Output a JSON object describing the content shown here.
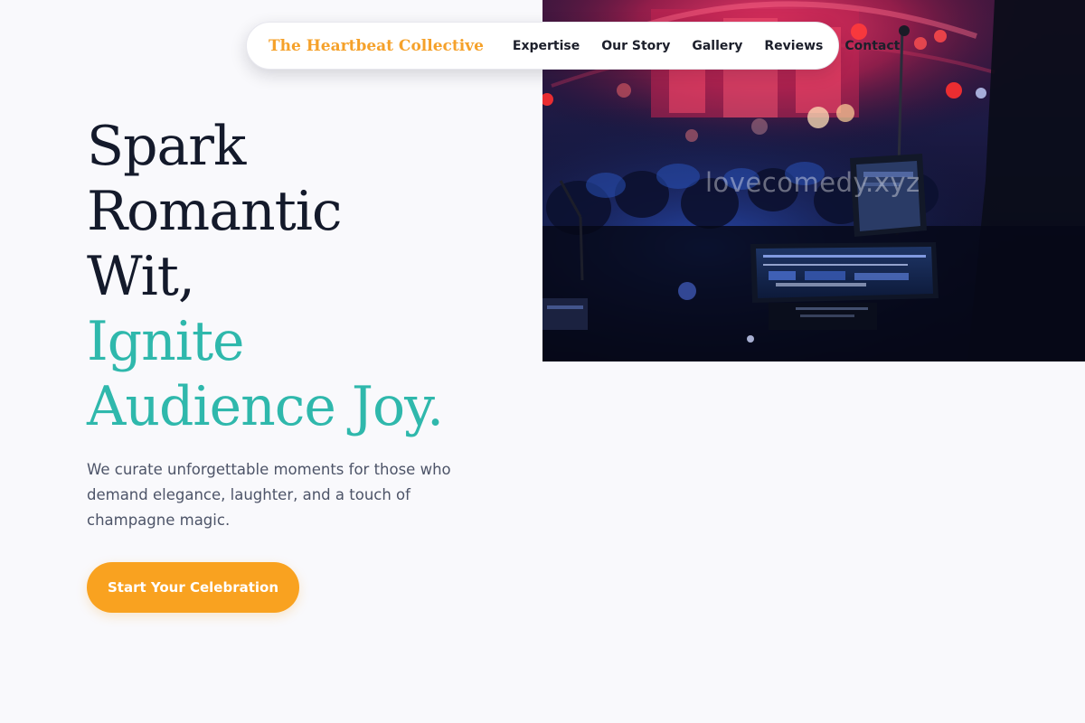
{
  "nav": {
    "brand": "The Heartbeat Collective",
    "links": [
      "Expertise",
      "Our Story",
      "Gallery",
      "Reviews",
      "Contact"
    ]
  },
  "hero": {
    "headline_lines": [
      "Spark",
      "Romantic",
      "Wit,"
    ],
    "headline_accent_lines": [
      "Ignite",
      "Audience Joy."
    ],
    "subtitle": "We curate unforgettable moments for those who demand elegance, laughter, and a touch of champagne magic.",
    "cta_label": "Start Your Celebration",
    "image": {
      "watermark": "lovecomedy.xyz",
      "subject": "concert stage with mixing console"
    }
  },
  "colors": {
    "brand": "#f5a12a",
    "accent_teal": "#2fb8ac",
    "cta": "#f9a220",
    "headline": "#141a2b",
    "background": "#f9f9fc"
  }
}
